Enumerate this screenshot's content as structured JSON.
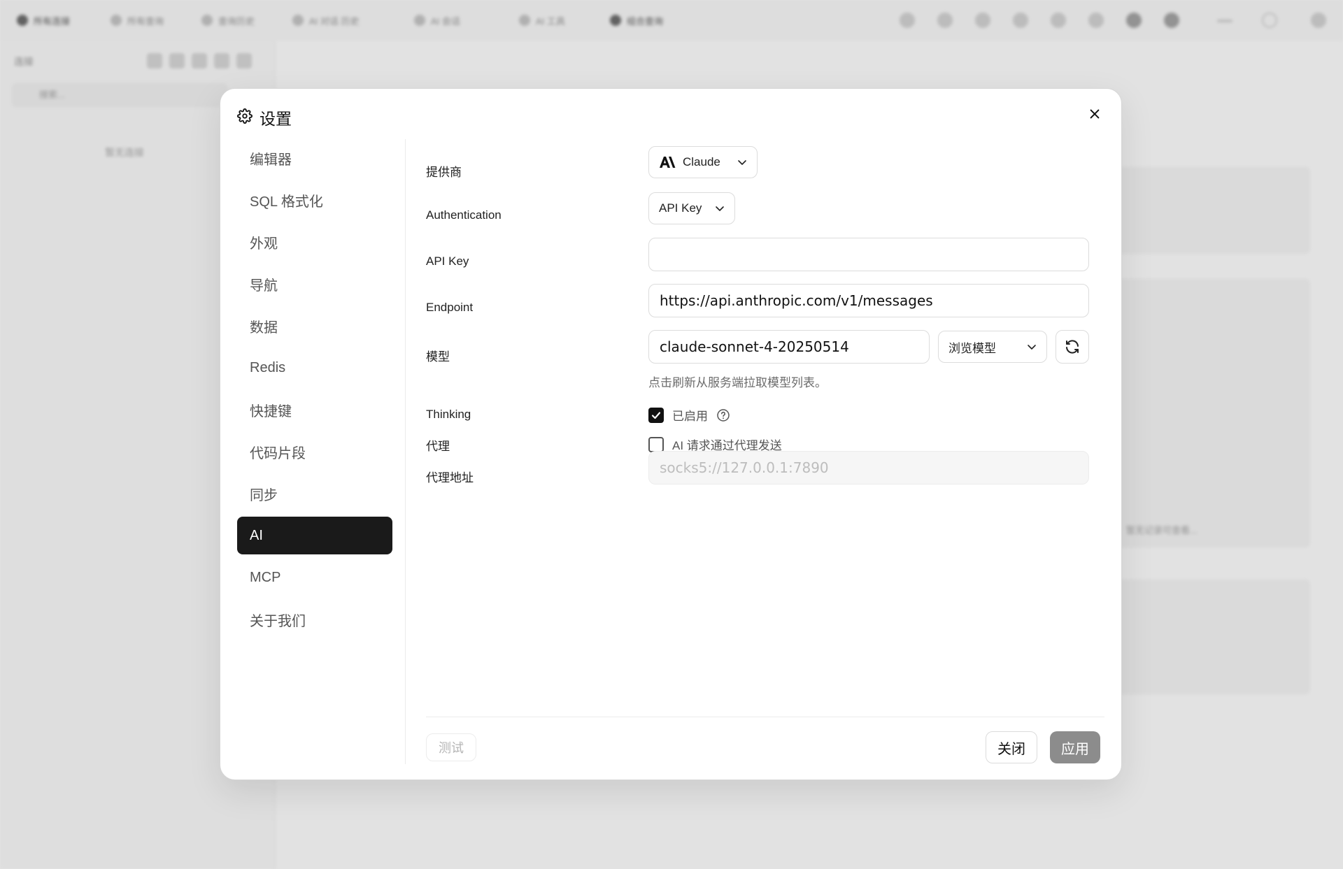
{
  "background": {
    "tabs": [
      "所有连接",
      "所有查询",
      "查询历史",
      "AI 对话 历史",
      "AI 会话",
      "AI 工具",
      "组合查询"
    ],
    "sidebar_title": "连接",
    "sidebar_search_placeholder": "搜索...",
    "sidebar_empty": "暂无连接",
    "card_hint": "暂无记录可查看..."
  },
  "dialog": {
    "title": "设置",
    "nav": [
      {
        "label": "编辑器"
      },
      {
        "label": "SQL 格式化"
      },
      {
        "label": "外观"
      },
      {
        "label": "导航"
      },
      {
        "label": "数据"
      },
      {
        "label": "Redis"
      },
      {
        "label": "快捷键"
      },
      {
        "label": "代码片段"
      },
      {
        "label": "同步"
      },
      {
        "label": "AI",
        "active": true
      },
      {
        "label": "MCP"
      },
      {
        "label": "关于我们"
      }
    ],
    "form": {
      "provider_label": "提供商",
      "provider_value": "Claude",
      "auth_label": "Authentication",
      "auth_value": "API Key",
      "api_key_label": "API Key",
      "api_key_value": "",
      "endpoint_label": "Endpoint",
      "endpoint_value": "https://api.anthropic.com/v1/messages",
      "model_label": "模型",
      "model_value": "claude-sonnet-4-20250514",
      "browse_models": "浏览模型",
      "model_hint": "点击刷新从服务端拉取模型列表。",
      "thinking_label": "Thinking",
      "thinking_checked": true,
      "thinking_text": "已启用",
      "proxy_label": "代理",
      "proxy_checked": false,
      "proxy_text": "AI 请求通过代理发送",
      "proxy_addr_label": "代理地址",
      "proxy_addr_placeholder": "socks5://127.0.0.1:7890"
    },
    "footer": {
      "test": "测试",
      "close": "关闭",
      "apply": "应用"
    }
  },
  "colors": {
    "accent": "#1a1a1a",
    "apply_bg": "#8c8c8c",
    "bg": "#ececec"
  }
}
